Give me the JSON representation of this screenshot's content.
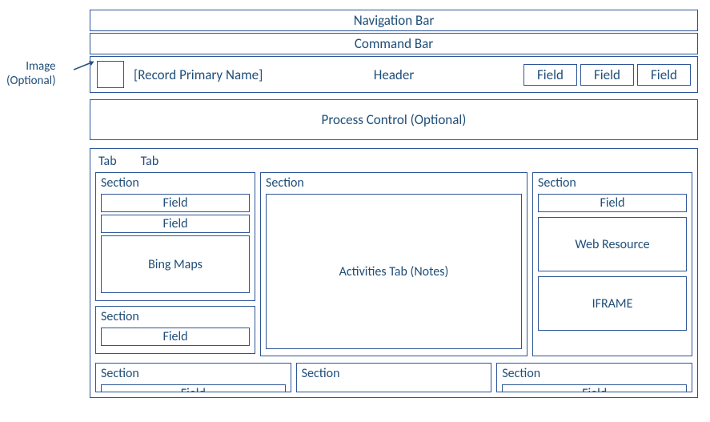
{
  "callout": {
    "line1": "Image",
    "line2": "(Optional)"
  },
  "bars": {
    "navigation": "Navigation Bar",
    "command": "Command Bar"
  },
  "header": {
    "primaryName": "[Record Primary Name]",
    "center": "Header",
    "fields": [
      "Field",
      "Field",
      "Field"
    ]
  },
  "processControl": "Process Control (Optional)",
  "tabs": [
    "Tab",
    "Tab"
  ],
  "row1": {
    "leftTop": {
      "title": "Section",
      "fields": [
        "Field",
        "Field"
      ],
      "bingMaps": "Bing Maps"
    },
    "leftBottom": {
      "title": "Section",
      "fields": [
        "Field"
      ]
    },
    "middle": {
      "title": "Section",
      "body": "Activities Tab (Notes)"
    },
    "right": {
      "title": "Section",
      "fields": [
        "Field"
      ],
      "webResource": "Web Resource",
      "iframe": "IFRAME"
    }
  },
  "row2": {
    "left": {
      "title": "Section",
      "field": "Field"
    },
    "middle": {
      "title": "Section"
    },
    "right": {
      "title": "Section",
      "field": "Field"
    }
  }
}
